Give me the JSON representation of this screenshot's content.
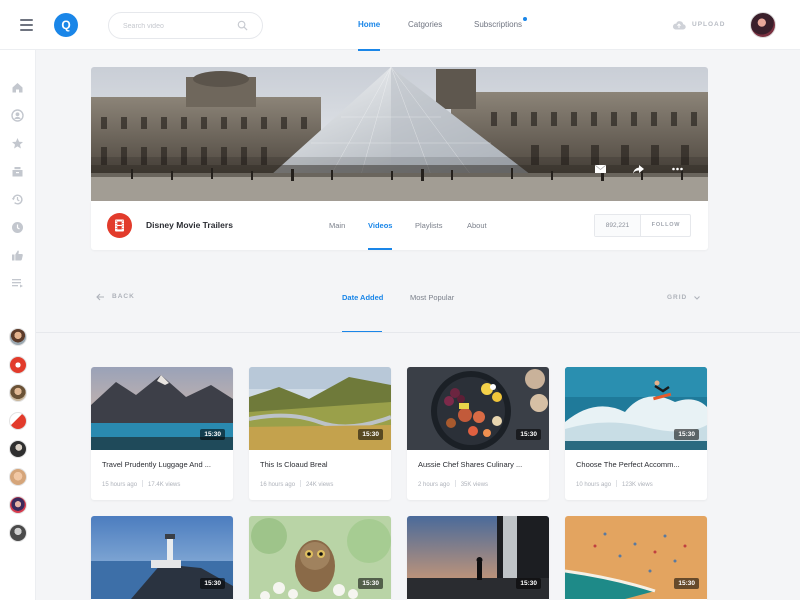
{
  "app": {
    "logo_letter": "Q",
    "brand_color": "#1a86e8"
  },
  "header": {
    "search_placeholder": "Search video",
    "nav": [
      {
        "label": "Home",
        "active": true
      },
      {
        "label": "Catgories",
        "active": false
      },
      {
        "label": "Subscriptions",
        "active": false,
        "has_notification_dot": true
      }
    ],
    "upload_label": "UPLOAD",
    "icons": [
      "menu-icon",
      "search-icon",
      "upload-cloud-icon",
      "avatar"
    ]
  },
  "sidebar": {
    "icons": [
      "home-icon",
      "user-icon",
      "star-icon",
      "inbox-icon",
      "history-icon",
      "clock-icon",
      "thumbs-up-icon",
      "queue-list-icon"
    ],
    "subscriptions": [
      "subscription-avatar-1",
      "subscription-avatar-2",
      "subscription-avatar-3",
      "subscription-avatar-4",
      "subscription-avatar-5",
      "subscription-avatar-6",
      "subscription-avatar-7",
      "subscription-avatar-8"
    ]
  },
  "channel": {
    "name": "Disney Movie Trailers",
    "banner_actions": [
      "mail-icon",
      "share-icon",
      "more-icon"
    ],
    "tabs": [
      {
        "label": "Main",
        "active": false
      },
      {
        "label": "Videos",
        "active": true
      },
      {
        "label": "Playlists",
        "active": false
      },
      {
        "label": "About",
        "active": false
      }
    ],
    "subscriber_count": "892,221",
    "follow_label": "FOLLOW"
  },
  "filters": {
    "back_label": "BACK",
    "options": [
      {
        "label": "Date Added",
        "active": true
      },
      {
        "label": "Most Popular",
        "active": false
      }
    ],
    "view_label": "GRID"
  },
  "videos": [
    {
      "title": "Travel Prudently Luggage And ...",
      "age": "15 hours ago",
      "views": "17.4K views",
      "duration": "15:30"
    },
    {
      "title": "This Is Cloaud Breal",
      "age": "16 hours ago",
      "views": "24K views",
      "duration": "15:30"
    },
    {
      "title": "Aussie Chef Shares Culinary ...",
      "age": "2 hours ago",
      "views": "35K views",
      "duration": "15:30"
    },
    {
      "title": "Choose The Perfect Accomm...",
      "age": "10 hours ago",
      "views": "123K views",
      "duration": "15:30"
    },
    {
      "title": "",
      "age": "",
      "views": "",
      "duration": "15:30"
    },
    {
      "title": "",
      "age": "",
      "views": "",
      "duration": "15:30"
    },
    {
      "title": "",
      "age": "",
      "views": "",
      "duration": "15:30"
    },
    {
      "title": "",
      "age": "",
      "views": "",
      "duration": "15:30"
    }
  ]
}
